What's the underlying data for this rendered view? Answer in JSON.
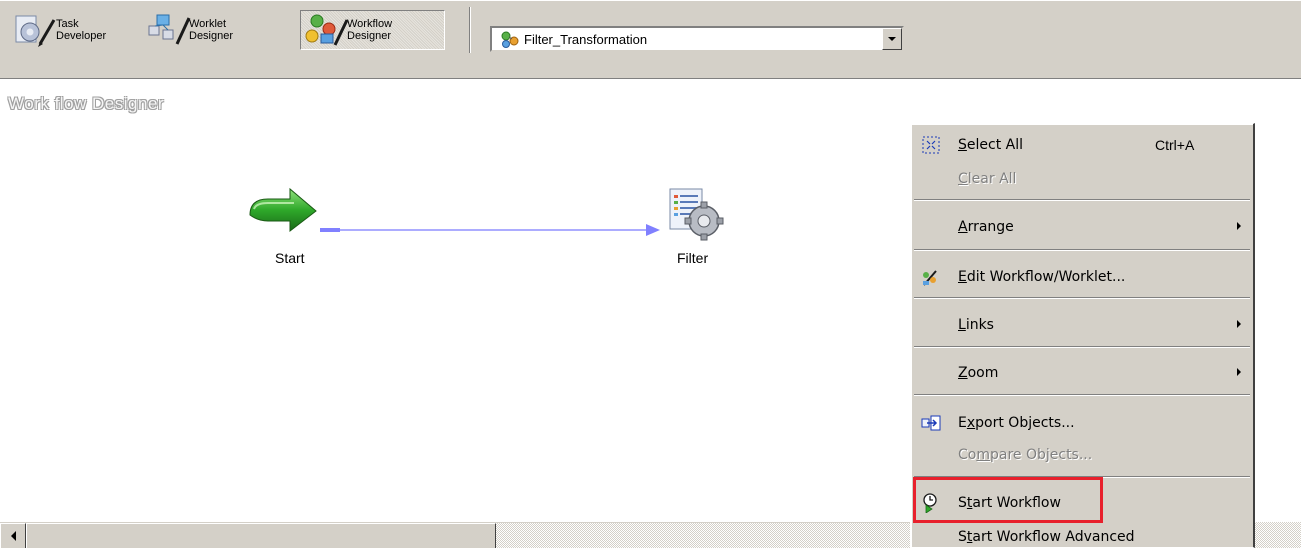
{
  "toolbar": {
    "tools": [
      {
        "label": "Task\nDeveloper",
        "active": false
      },
      {
        "label": "Worklet\nDesigner",
        "active": false
      },
      {
        "label": "Workflow\nDesigner",
        "active": true
      }
    ],
    "workflow_combo": {
      "value": "Filter_Transformation",
      "icon": "workflow-icon"
    }
  },
  "canvas": {
    "title": "Work flow Designer",
    "tasks": [
      {
        "label": "Start",
        "icon": "start-arrow-icon"
      },
      {
        "label": "Filter",
        "icon": "session-task-icon"
      }
    ]
  },
  "context_menu": {
    "items": [
      {
        "label": "Select All",
        "mnemonic": "S",
        "shortcut": "Ctrl+A",
        "enabled": true,
        "icon": "select-all-icon"
      },
      {
        "label": "Clear All",
        "mnemonic": "C",
        "enabled": false
      },
      {
        "label": "Arrange",
        "mnemonic": "A",
        "enabled": true,
        "submenu": true
      },
      {
        "label": "Edit Workflow/Worklet...",
        "mnemonic": "E",
        "enabled": true,
        "icon": "edit-workflow-icon"
      },
      {
        "label": "Links",
        "mnemonic": "L",
        "enabled": true,
        "submenu": true
      },
      {
        "label": "Zoom",
        "mnemonic": "Z",
        "enabled": true,
        "submenu": true
      },
      {
        "label": "Export Objects...",
        "mnemonic": "x",
        "enabled": true,
        "icon": "export-objects-icon"
      },
      {
        "label": "Compare Objects...",
        "mnemonic": "m",
        "enabled": false
      },
      {
        "label": "Start Workflow",
        "mnemonic": "t",
        "enabled": true,
        "highlighted": true,
        "icon": "start-workflow-icon"
      },
      {
        "label": "Start Workflow Advanced",
        "mnemonic": "t",
        "enabled": true
      }
    ]
  },
  "colors": {
    "chrome": "#d4d0c8",
    "highlight_border": "#e8202c",
    "link_line": "#8080ff",
    "disabled_text": "#808080"
  }
}
